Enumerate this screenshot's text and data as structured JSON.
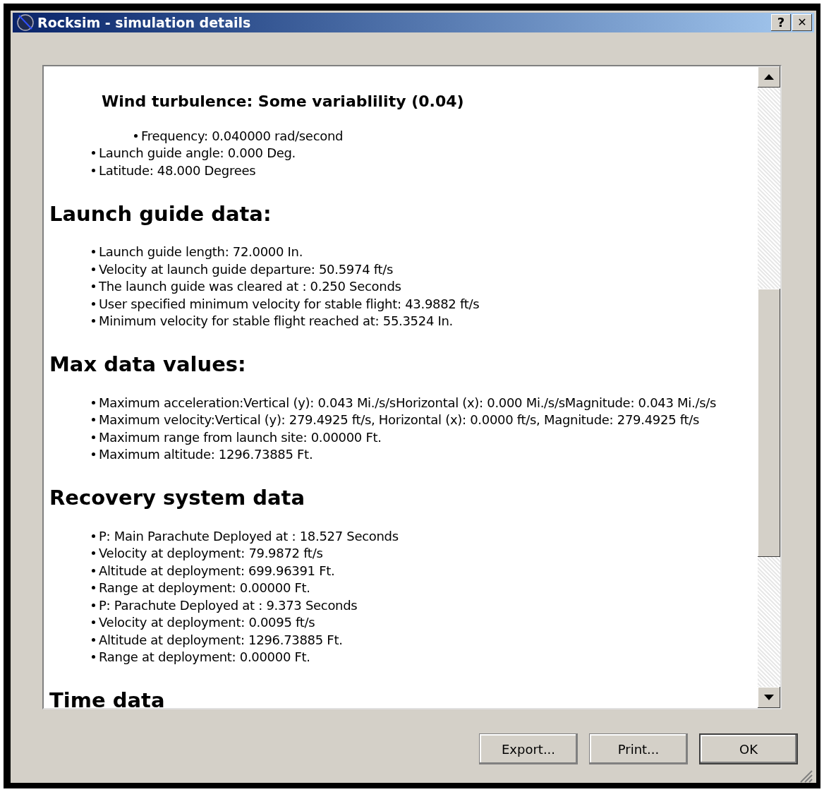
{
  "window": {
    "title": "Rocksim - simulation details",
    "help_button": "?",
    "close_button": "✕"
  },
  "sections": [
    {
      "items": [
        {
          "kind": "subheading",
          "text": "Wind turbulence: Some variablility (0.04)",
          "children": [
            {
              "kind": "bullet",
              "text": "Frequency: 0.040000 rad/second"
            }
          ]
        },
        {
          "kind": "bullet",
          "text": "Launch guide angle: 0.000 Deg."
        },
        {
          "kind": "bullet",
          "text": "Latitude: 48.000 Degrees"
        }
      ]
    },
    {
      "heading": "Launch guide data:",
      "items": [
        {
          "kind": "bullet",
          "text": "Launch guide length: 72.0000 In."
        },
        {
          "kind": "bullet",
          "text": "Velocity at launch guide departure: 50.5974 ft/s"
        },
        {
          "kind": "bullet",
          "text": "The launch guide was cleared at : 0.250 Seconds"
        },
        {
          "kind": "bullet",
          "text": "User specified minimum velocity for stable flight: 43.9882 ft/s"
        },
        {
          "kind": "bullet",
          "text": "Minimum velocity for stable flight reached at: 55.3524 In."
        }
      ]
    },
    {
      "heading": "Max data values:",
      "items": [
        {
          "kind": "bullet",
          "text": "Maximum acceleration:Vertical (y): 0.043 Mi./s/sHorizontal (x): 0.000 Mi./s/sMagnitude: 0.043 Mi./s/s"
        },
        {
          "kind": "bullet",
          "text": "Maximum velocity:Vertical (y): 279.4925 ft/s, Horizontal (x): 0.0000 ft/s, Magnitude: 279.4925 ft/s"
        },
        {
          "kind": "bullet",
          "text": "Maximum range from launch site: 0.00000 Ft."
        },
        {
          "kind": "bullet",
          "text": "Maximum altitude: 1296.73885 Ft."
        }
      ]
    },
    {
      "heading": "Recovery system data",
      "items": [
        {
          "kind": "bullet",
          "text": "P: Main Parachute Deployed at : 18.527 Seconds"
        },
        {
          "kind": "bullet",
          "text": "Velocity at deployment: 79.9872 ft/s"
        },
        {
          "kind": "bullet",
          "text": "Altitude at deployment: 699.96391 Ft."
        },
        {
          "kind": "bullet",
          "text": "Range at deployment: 0.00000 Ft."
        },
        {
          "kind": "bullet",
          "text": "P: Parachute Deployed at : 9.373 Seconds"
        },
        {
          "kind": "bullet",
          "text": "Velocity at deployment: 0.0095 ft/s"
        },
        {
          "kind": "bullet",
          "text": "Altitude at deployment: 1296.73885 Ft."
        },
        {
          "kind": "bullet",
          "text": "Range at deployment: 0.00000 Ft."
        }
      ]
    },
    {
      "heading": "Time data"
    }
  ],
  "buttons": [
    {
      "label": "Export...",
      "default": false
    },
    {
      "label": "Print...",
      "default": false
    },
    {
      "label": "OK",
      "default": true
    }
  ]
}
